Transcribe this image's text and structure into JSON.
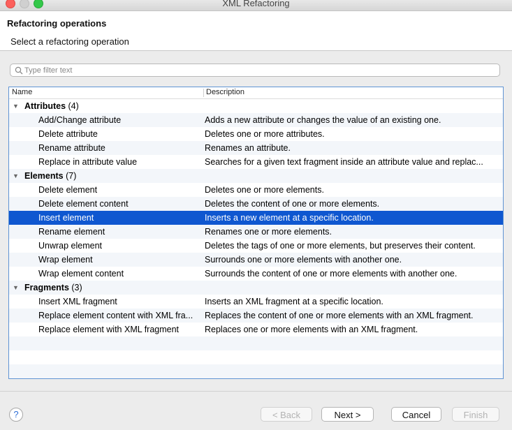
{
  "window": {
    "title": "XML Refactoring"
  },
  "banner": {
    "title": "Refactoring operations",
    "subtitle": "Select a refactoring operation"
  },
  "filter": {
    "placeholder": "Type filter text",
    "value": ""
  },
  "table": {
    "columns": [
      "Name",
      "Description"
    ],
    "groups": [
      {
        "label": "Attributes",
        "count": "(4)",
        "items": [
          {
            "name": "Add/Change attribute",
            "description": "Adds a new attribute or changes the value of an existing one."
          },
          {
            "name": "Delete attribute",
            "description": "Deletes one or more attributes."
          },
          {
            "name": "Rename attribute",
            "description": "Renames an attribute."
          },
          {
            "name": "Replace in attribute value",
            "description": "Searches for a given text fragment inside an attribute value and replac..."
          }
        ]
      },
      {
        "label": "Elements",
        "count": "(7)",
        "items": [
          {
            "name": "Delete element",
            "description": "Deletes one or more elements."
          },
          {
            "name": "Delete element content",
            "description": "Deletes the content of one or more elements."
          },
          {
            "name": "Insert element",
            "description": "Inserts a new element at a specific location.",
            "selected": true
          },
          {
            "name": "Rename element",
            "description": "Renames one or more elements."
          },
          {
            "name": "Unwrap element",
            "description": "Deletes the tags of one or more elements, but preserves their content."
          },
          {
            "name": "Wrap element",
            "description": "Surrounds one or more elements with another one."
          },
          {
            "name": "Wrap element content",
            "description": "Surrounds the content of one or more elements with another one."
          }
        ]
      },
      {
        "label": "Fragments",
        "count": "(3)",
        "items": [
          {
            "name": "Insert XML fragment",
            "description": "Inserts an XML fragment at a specific location."
          },
          {
            "name": "Replace element content with XML fra...",
            "description": "Replaces the content of one or more elements with an XML fragment."
          },
          {
            "name": "Replace element with XML fragment",
            "description": "Replaces one or more elements with an XML fragment."
          }
        ]
      }
    ]
  },
  "buttons": {
    "help": "?",
    "back": "< Back",
    "next": "Next >",
    "cancel": "Cancel",
    "finish": "Finish"
  },
  "colors": {
    "selection": "#0f57d0",
    "tree_border": "#5f94d4"
  }
}
